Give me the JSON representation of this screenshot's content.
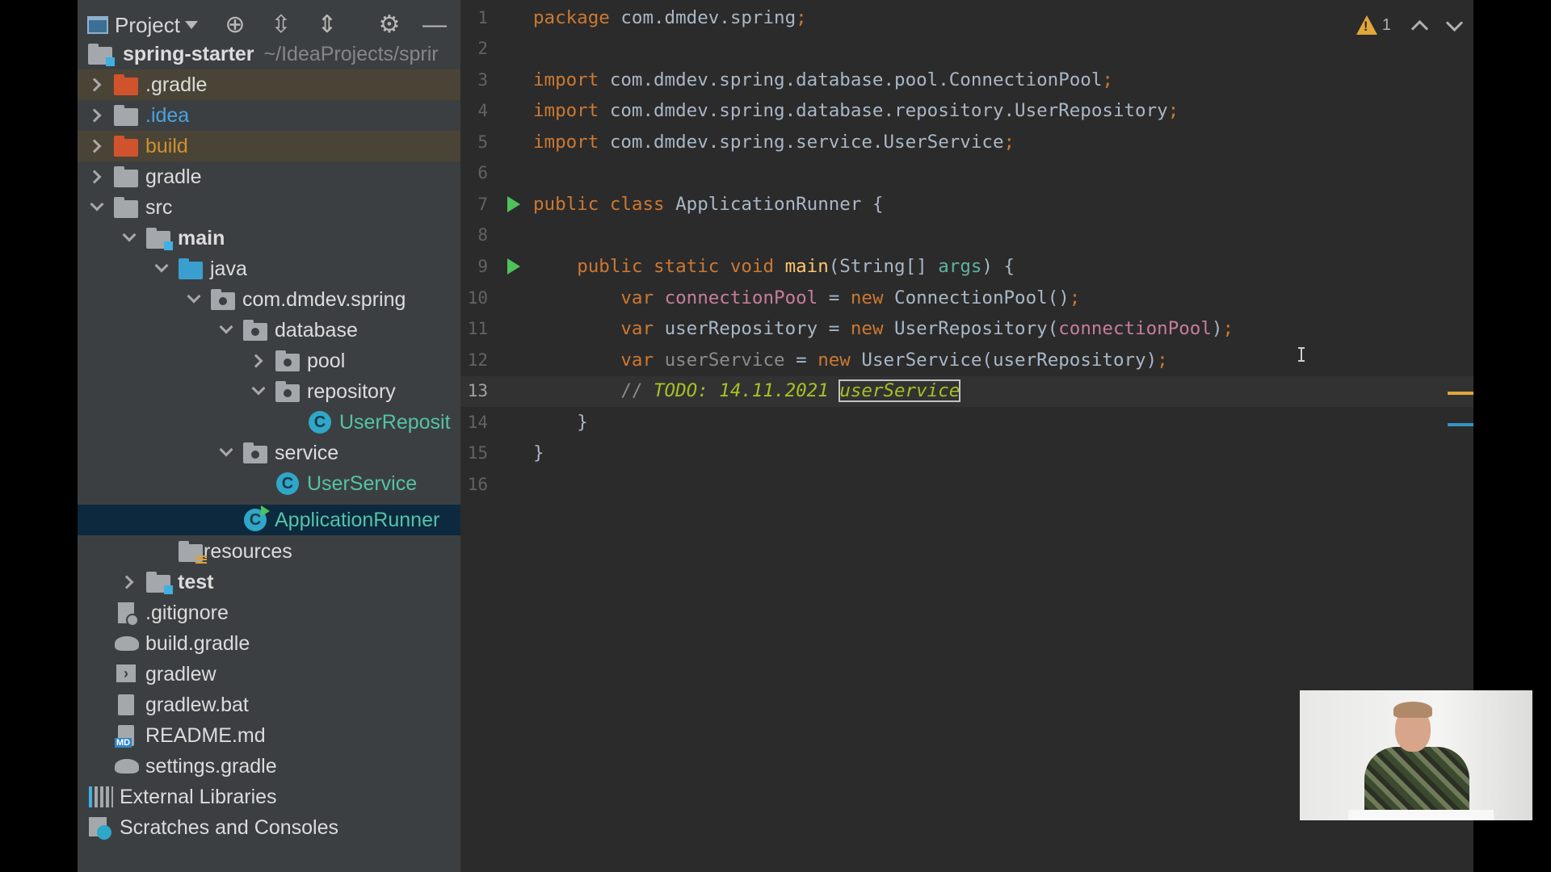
{
  "toolbar": {
    "project_label": "Project"
  },
  "tree": {
    "root": {
      "name": "spring-starter",
      "path": "~/IdeaProjects/sprir"
    },
    "items": [
      {
        "label": ".gradle"
      },
      {
        "label": ".idea"
      },
      {
        "label": "build"
      },
      {
        "label": "gradle"
      },
      {
        "label": "src"
      },
      {
        "label": "main"
      },
      {
        "label": "java"
      },
      {
        "label": "com.dmdev.spring"
      },
      {
        "label": "database"
      },
      {
        "label": "pool"
      },
      {
        "label": "repository"
      },
      {
        "label": "UserReposit"
      },
      {
        "label": "service"
      },
      {
        "label": "UserService"
      },
      {
        "label": "ApplicationRunner"
      },
      {
        "label": "resources"
      },
      {
        "label": "test"
      },
      {
        "label": ".gitignore"
      },
      {
        "label": "build.gradle"
      },
      {
        "label": "gradlew"
      },
      {
        "label": "gradlew.bat"
      },
      {
        "label": "README.md"
      },
      {
        "label": "settings.gradle"
      },
      {
        "label": "External Libraries"
      },
      {
        "label": "Scratches and Consoles"
      }
    ]
  },
  "editor": {
    "warning_count": "1",
    "line_numbers": [
      "1",
      "2",
      "3",
      "4",
      "5",
      "6",
      "7",
      "8",
      "9",
      "10",
      "11",
      "12",
      "13",
      "14",
      "15",
      "16"
    ],
    "tokens": {
      "l1": [
        "package",
        "com.dmdev.spring",
        ";"
      ],
      "l3": [
        "import",
        "com.dmdev.spring.database.pool.ConnectionPool",
        ";"
      ],
      "l4": [
        "import",
        "com.dmdev.spring.database.repository.UserRepository",
        ";"
      ],
      "l5": [
        "import",
        "com.dmdev.spring.service.UserService",
        ";"
      ],
      "l7": [
        "public class",
        "ApplicationRunner {"
      ],
      "l9": [
        "public static void",
        "main",
        "(String[]",
        "args",
        ") {"
      ],
      "l10": [
        "var",
        "connectionPool",
        "=",
        "new",
        "ConnectionPool()",
        ";"
      ],
      "l11": [
        "var",
        "userRepository",
        "=",
        "new",
        "UserRepository(",
        "connectionPool",
        ")",
        ";"
      ],
      "l12": [
        "var",
        "userService",
        "=",
        "new",
        "UserService(userRepository)",
        ";"
      ],
      "l13": [
        "//",
        "TODO: 14.11.2021",
        "userService"
      ],
      "l14": [
        "}"
      ],
      "l15": [
        "}"
      ]
    }
  },
  "colors": {
    "keyword": "#cc7832",
    "local_var": "#c77d9b",
    "param": "#5fb3a1",
    "method": "#ffc66d",
    "todo": "#a8c023",
    "selection": "#0d293e"
  }
}
